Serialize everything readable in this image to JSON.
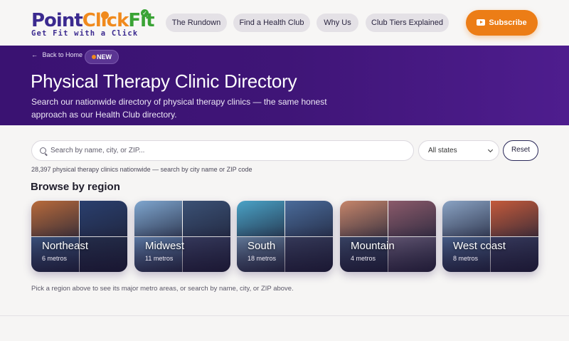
{
  "header": {
    "logo": {
      "name_part1": "Point",
      "name_part2": "Click",
      "name_part3": "Fit",
      "tagline": "Get Fit with a Click"
    },
    "nav": [
      "The Rundown",
      "Find a Health Club",
      "Why Us",
      "Club Tiers Explained"
    ],
    "subscribe_label": "Subscribe"
  },
  "hero": {
    "back_label": "Back to Home",
    "badge": "NEW",
    "title": "Physical Therapy Clinic Directory",
    "subtitle": "Search our nationwide directory of physical therapy clinics — the same honest approach as our Health Club directory."
  },
  "search": {
    "placeholder": "Search by name, city, or ZIP...",
    "state_value": "All states",
    "reset_label": "Reset",
    "count_text": "28,397 physical therapy clinics nationwide — search by city name or ZIP code"
  },
  "regions": {
    "title": "Browse by region",
    "items": [
      {
        "name": "Northeast",
        "metros": "6 metros",
        "colors": [
          "#b86a3a",
          "#2a3f6e",
          "#3f5a86",
          "#26324f"
        ]
      },
      {
        "name": "Midwest",
        "metros": "11 metros",
        "colors": [
          "#7fa6cf",
          "#3b5175",
          "#6486b3",
          "#3a3f63"
        ]
      },
      {
        "name": "South",
        "metros": "18 metros",
        "colors": [
          "#4aa3c7",
          "#4a6b9a",
          "#6c88a8",
          "#3a4060"
        ]
      },
      {
        "name": "Mountain",
        "metros": "4 metros",
        "colors": [
          "#c6856a",
          "#8b5a6a",
          "#3d4a6b",
          "#6a5d7a"
        ]
      },
      {
        "name": "West coast",
        "metros": "8 metros",
        "colors": [
          "#8aa3c4",
          "#c45a3a",
          "#4d6793",
          "#3b3f63"
        ]
      }
    ]
  },
  "hint": "Pick a region above to see its major metro areas, or search by name, city, or ZIP above.",
  "colors": {
    "brand_purple": "#3f1577",
    "accent_orange": "#ec7d16"
  }
}
